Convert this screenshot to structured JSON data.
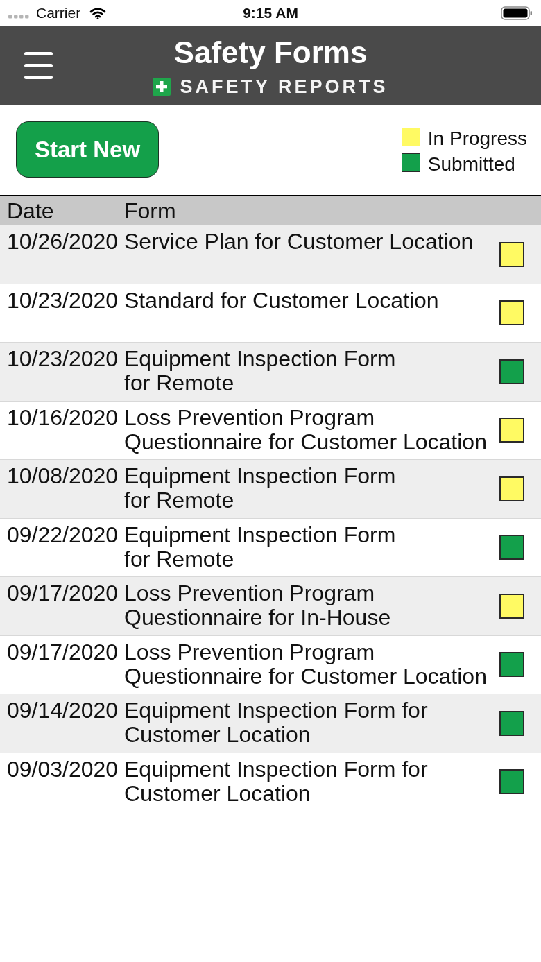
{
  "status_bar": {
    "carrier": "Carrier",
    "time": "9:15 AM"
  },
  "header": {
    "title": "Safety Forms",
    "logo_text": "SAFETY REPORTS"
  },
  "start_button": {
    "label": "Start New"
  },
  "legend": [
    {
      "label": "In Progress",
      "color": "#fffa63"
    },
    {
      "label": "Submitted",
      "color": "#13a04b"
    }
  ],
  "table": {
    "columns": [
      "Date",
      "Form"
    ],
    "rows": [
      {
        "date": "10/26/2020",
        "form": "Service Plan for Customer Location",
        "color": "#fffa63"
      },
      {
        "date": "10/23/2020",
        "form": "Standard for Customer Location",
        "color": "#fffa63"
      },
      {
        "date": "10/23/2020",
        "form": "Equipment Inspection Form\nfor Remote",
        "color": "#13a04b"
      },
      {
        "date": "10/16/2020",
        "form": "Loss Prevention Program\nQuestionnaire for Customer Location",
        "color": "#fffa63"
      },
      {
        "date": "10/08/2020",
        "form": "Equipment Inspection Form\nfor Remote",
        "color": "#fffa63"
      },
      {
        "date": "09/22/2020",
        "form": "Equipment Inspection Form\nfor Remote",
        "color": "#13a04b"
      },
      {
        "date": "09/17/2020",
        "form": "Loss Prevention Program\nQuestionnaire for In-House",
        "color": "#fffa63"
      },
      {
        "date": "09/17/2020",
        "form": "Loss Prevention Program\nQuestionnaire for Customer Location",
        "color": "#13a04b"
      },
      {
        "date": "09/14/2020",
        "form": "Equipment Inspection Form for\nCustomer Location",
        "color": "#13a04b"
      },
      {
        "date": "09/03/2020",
        "form": "Equipment Inspection Form for\nCustomer Location",
        "color": "#13a04b"
      }
    ]
  }
}
